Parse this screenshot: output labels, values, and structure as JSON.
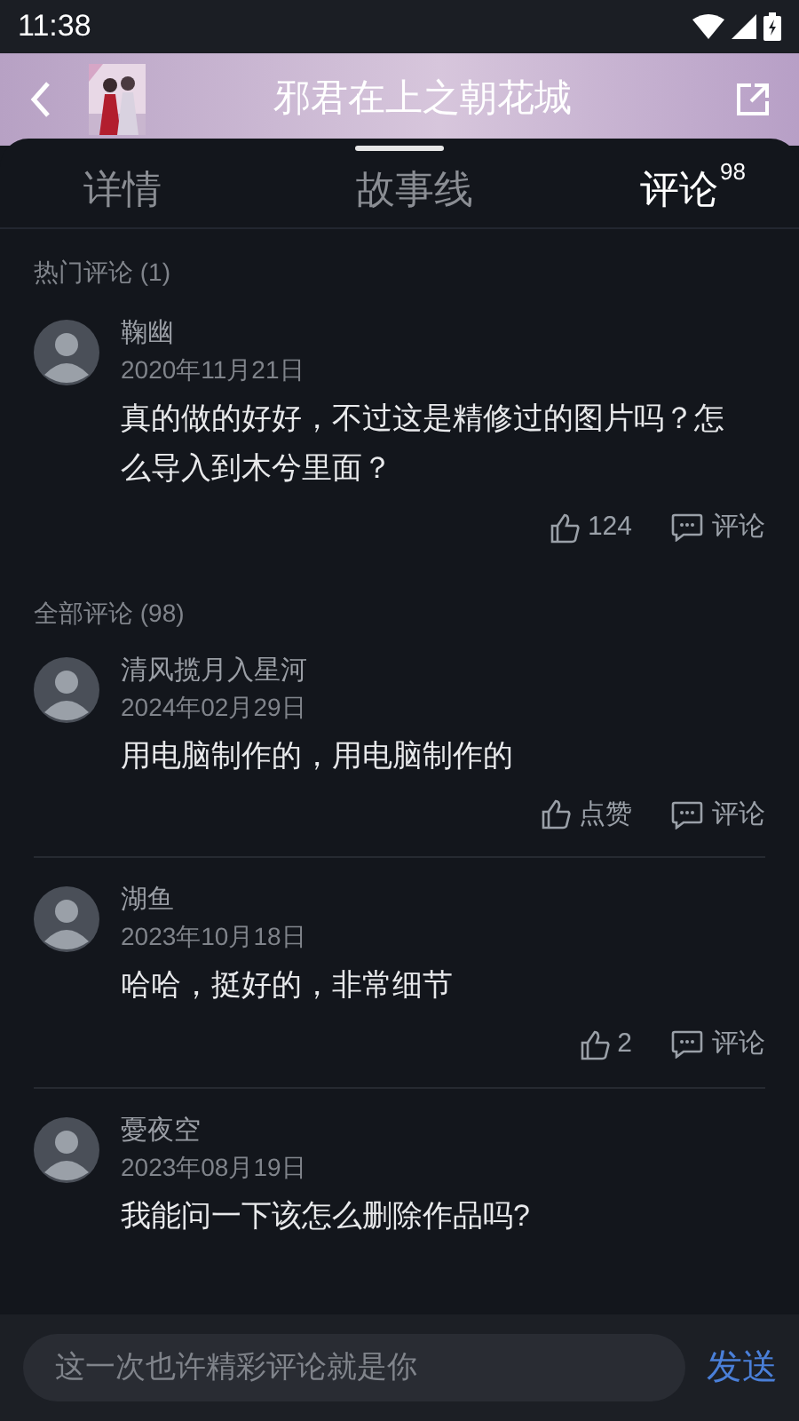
{
  "status_bar": {
    "time": "11:38"
  },
  "header": {
    "title": "邪君在上之朝花城"
  },
  "tabs": [
    {
      "label": "详情",
      "selected": false
    },
    {
      "label": "故事线",
      "selected": false
    },
    {
      "label": "评论",
      "badge": "98",
      "selected": true
    }
  ],
  "sections": [
    {
      "title": "热门评论 (1)",
      "comments": [
        {
          "author": "鞠幽",
          "date": "2020年11月21日",
          "text": "真的做的好好，不过这是精修过的图片吗？怎么导入到木兮里面？",
          "likes": "124",
          "reply": "评论"
        }
      ]
    },
    {
      "title": "全部评论 (98)",
      "comments": [
        {
          "author": "清风揽月入星河",
          "date": "2024年02月29日",
          "text": "用电脑制作的，用电脑制作的",
          "likes": "点赞",
          "reply": "评论"
        },
        {
          "author": "湖鱼",
          "date": "2023年10月18日",
          "text": "哈哈，挺好的，非常细节",
          "likes": "2",
          "reply": "评论"
        },
        {
          "author": "憂夜空",
          "date": "2023年08月19日",
          "text": "我能问一下该怎么删除作品吗?"
        }
      ]
    }
  ],
  "composer": {
    "placeholder": "这一次也许精彩评论就是你",
    "send": "发送"
  }
}
